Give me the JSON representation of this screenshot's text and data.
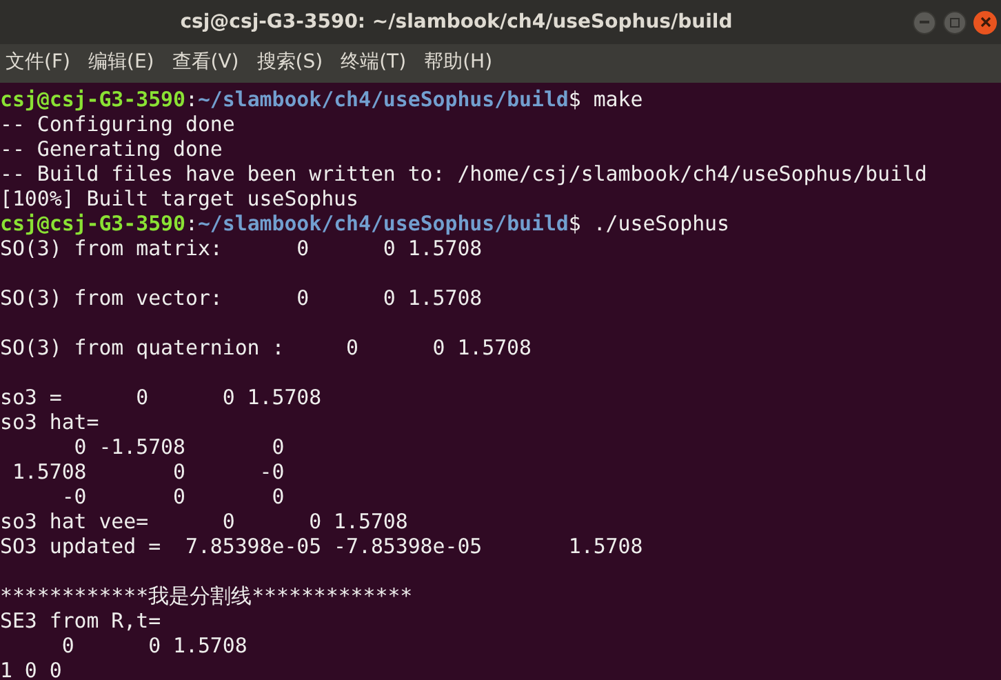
{
  "window": {
    "title": "csj@csj-G3-3590: ~/slambook/ch4/useSophus/build"
  },
  "menu": [
    "文件(F)",
    "编辑(E)",
    "查看(V)",
    "搜索(S)",
    "终端(T)",
    "帮助(H)"
  ],
  "terminal": {
    "lines": [
      {
        "kind": "prompt",
        "user": "csj@csj-G3-3590",
        "separator": ":",
        "path": "~/slambook/ch4/useSophus/build",
        "symbol": "$",
        "command": "make"
      },
      {
        "kind": "output",
        "text": "-- Configuring done"
      },
      {
        "kind": "output",
        "text": "-- Generating done"
      },
      {
        "kind": "output",
        "text": "-- Build files have been written to: /home/csj/slambook/ch4/useSophus/build"
      },
      {
        "kind": "output",
        "text": "[100%] Built target useSophus"
      },
      {
        "kind": "prompt",
        "user": "csj@csj-G3-3590",
        "separator": ":",
        "path": "~/slambook/ch4/useSophus/build",
        "symbol": "$",
        "command": "./useSophus"
      },
      {
        "kind": "output",
        "text": "SO(3) from matrix:      0      0 1.5708"
      },
      {
        "kind": "blank"
      },
      {
        "kind": "output",
        "text": "SO(3) from vector:      0      0 1.5708"
      },
      {
        "kind": "blank"
      },
      {
        "kind": "output",
        "text": "SO(3) from quaternion :     0      0 1.5708"
      },
      {
        "kind": "blank"
      },
      {
        "kind": "output",
        "text": "so3 =      0      0 1.5708"
      },
      {
        "kind": "output",
        "text": "so3 hat="
      },
      {
        "kind": "output",
        "text": "      0 -1.5708       0"
      },
      {
        "kind": "output",
        "text": " 1.5708       0      -0"
      },
      {
        "kind": "output",
        "text": "     -0       0       0"
      },
      {
        "kind": "output",
        "text": "so3 hat vee=      0      0 1.5708"
      },
      {
        "kind": "output",
        "text": "SO3 updated =  7.85398e-05 -7.85398e-05       1.5708"
      },
      {
        "kind": "blank"
      },
      {
        "kind": "output",
        "text": "************我是分割线*************"
      },
      {
        "kind": "output",
        "text": "SE3 from R,t="
      },
      {
        "kind": "output",
        "text": "     0      0 1.5708"
      },
      {
        "kind": "output",
        "text": "1 0 0"
      }
    ]
  }
}
